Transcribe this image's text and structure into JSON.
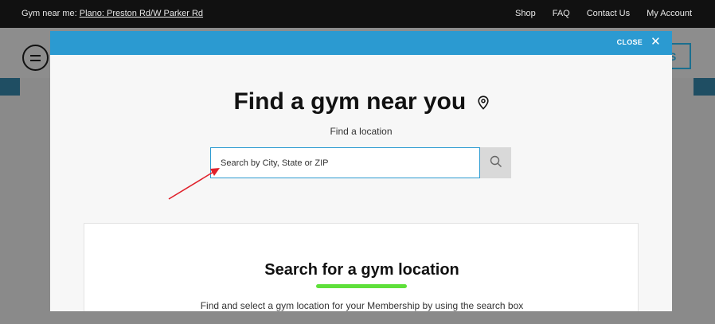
{
  "topbar": {
    "near_label": "Gym near me:",
    "near_link": "Plano: Preston Rd/W Parker Rd",
    "links": [
      "Shop",
      "FAQ",
      "Contact Us",
      "My Account"
    ]
  },
  "background": {
    "right_button_fragment": "S"
  },
  "modal": {
    "close_label": "CLOSE",
    "close_icon": "close-icon",
    "title": "Find a gym near you",
    "title_icon": "location-pin-icon",
    "subtitle": "Find a location",
    "search": {
      "placeholder": "Search by City, State or ZIP",
      "value": "",
      "button_icon": "search-icon"
    },
    "card": {
      "title": "Search for a gym location",
      "description": "Find and select a gym location for your Membership by using the search box"
    }
  },
  "colors": {
    "topbar_bg": "#111111",
    "modal_header": "#2b9ad1",
    "underline_accent": "#5ee03a",
    "annotation_arrow": "#e0202a"
  }
}
